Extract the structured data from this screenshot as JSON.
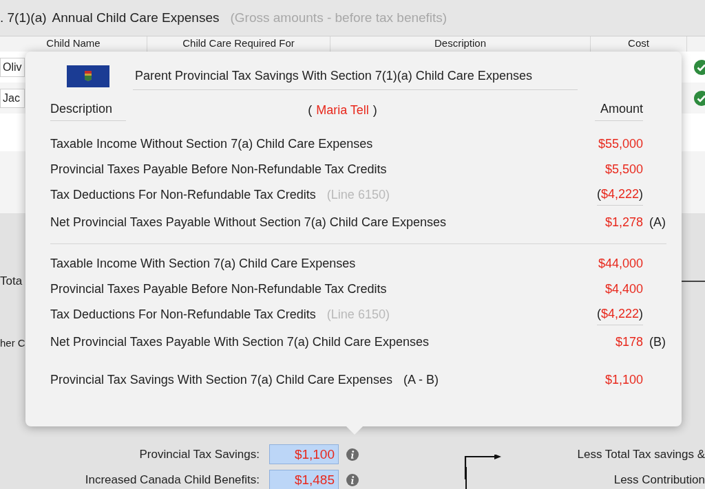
{
  "section_title": {
    "prefix": ". 7(1)(a)",
    "title": "Annual Child Care Expenses",
    "note": "(Gross amounts - before tax benefits)"
  },
  "table": {
    "columns": [
      "Child Name",
      "Child Care Required For",
      "Description",
      "Cost"
    ],
    "rows": [
      {
        "child_name": "Oliv"
      },
      {
        "child_name": "Jac"
      }
    ]
  },
  "side_labels": [
    "Tota",
    "her C"
  ],
  "popover": {
    "title": "Parent Provincial Tax Savings With Section 7(1)(a) Child Care Expenses",
    "header": {
      "description": "Description",
      "person_open": "(",
      "person": "Maria Tell",
      "person_close": ")",
      "amount": "Amount"
    },
    "groups": [
      [
        {
          "label": "Taxable Income Without Section 7(a) Child Care Expenses",
          "amount": "$55,000"
        },
        {
          "label": "Provincial Taxes Payable Before Non-Refundable Tax Credits",
          "amount": "$5,500"
        },
        {
          "label": "Tax Deductions For Non-Refundable Tax Credits",
          "note": "(Line 6150)",
          "open": "(",
          "amount": "$4,222",
          "close": ")"
        },
        {
          "label": "Net Provincial Taxes Payable Without Section 7(a) Child Care Expenses",
          "amount": "$1,278",
          "marker": "(A)"
        }
      ],
      [
        {
          "label": "Taxable Income With Section 7(a) Child Care Expenses",
          "amount": "$44,000"
        },
        {
          "label": "Provincial Taxes Payable Before Non-Refundable Tax Credits",
          "amount": "$4,400"
        },
        {
          "label": "Tax Deductions For Non-Refundable Tax Credits",
          "note": "(Line 6150)",
          "open": "(",
          "amount": "$4,222",
          "close": ")"
        },
        {
          "label": "Net Provincial Taxes Payable With Section 7(a) Child Care Expenses",
          "amount": "$178",
          "marker": "(B)"
        },
        {
          "label": "Provincial Tax Savings With Section 7(a) Child Care Expenses",
          "formula": "(A - B)",
          "amount": "$1,100"
        }
      ]
    ]
  },
  "summary": [
    {
      "label": "Provincial Tax Savings:",
      "value": "$1,100"
    },
    {
      "label": "Increased Canada Child Benefits:",
      "value": "$1,485"
    }
  ],
  "flow_labels": [
    "Less Total Tax savings &",
    "Less Contribution"
  ]
}
